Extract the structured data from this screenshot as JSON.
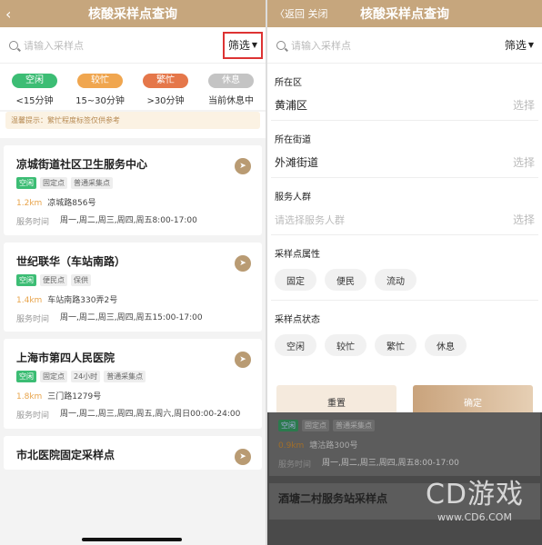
{
  "left": {
    "header": {
      "title": "核酸采样点查询",
      "back_icon": "‹"
    },
    "search": {
      "placeholder": "请输入采样点",
      "filter_label": "筛选",
      "filter_icon": "▼"
    },
    "legend": [
      {
        "chip": "空闲",
        "text": "<15分钟",
        "color": "#3cbd74"
      },
      {
        "chip": "较忙",
        "text": "15~30分钟",
        "color": "#f0a64f"
      },
      {
        "chip": "繁忙",
        "text": ">30分钟",
        "color": "#e5774a"
      },
      {
        "chip": "休息",
        "text": "当前休息中",
        "color": "#c4c4c4"
      }
    ],
    "tip": "温馨提示：繁忙程度标签仅供参考",
    "cards": [
      {
        "name": "凉城街道社区卫生服务中心",
        "tags": [
          "空闲",
          "固定点",
          "普通采集点"
        ],
        "km": "1.2km",
        "address": "凉城路856号",
        "hours_label": "服务时间",
        "hours": "周一,周二,周三,周四,周五8:00-17:00"
      },
      {
        "name": "世纪联华（车站南路）",
        "tags": [
          "空闲",
          "便民点",
          "保供"
        ],
        "km": "1.4km",
        "address": "车站南路330弄2号",
        "hours_label": "服务时间",
        "hours": "周一,周二,周三,周四,周五15:00-17:00"
      },
      {
        "name": "上海市第四人民医院",
        "tags": [
          "空闲",
          "固定点",
          "24小时",
          "普通采集点"
        ],
        "km": "1.8km",
        "address": "三门路1279号",
        "hours_label": "服务时间",
        "hours": "周一,周二,周三,周四,周五,周六,周日00:00-24:00"
      },
      {
        "name": "市北医院固定采样点",
        "tags": [],
        "km": "",
        "address": "",
        "hours_label": "",
        "hours": ""
      }
    ]
  },
  "right": {
    "header": {
      "back": "〈返回",
      "close": "关闭",
      "title": "核酸采样点查询"
    },
    "search": {
      "placeholder": "请输入采样点",
      "filter_label": "筛选",
      "filter_icon": "▼"
    },
    "district": {
      "label": "所在区",
      "value": "黄浦区",
      "action": "选择"
    },
    "street": {
      "label": "所在街道",
      "value": "外滩街道",
      "action": "选择"
    },
    "crowd": {
      "label": "服务人群",
      "placeholder": "请选择服务人群",
      "action": "选择"
    },
    "attr": {
      "label": "采样点属性",
      "options": [
        "固定",
        "便民",
        "流动"
      ]
    },
    "status": {
      "label": "采样点状态",
      "options": [
        "空闲",
        "较忙",
        "繁忙",
        "休息"
      ]
    },
    "reset": "重置",
    "confirm": "确定",
    "behind": {
      "tags": [
        "空闲",
        "固定点",
        "普通采集点"
      ],
      "km": "0.9km",
      "address": "塘沽路300号",
      "hours_label": "服务时间",
      "hours": "周一,周二,周三,周四,周五8:00-17:00",
      "next_name": "酒塘二村服务站采样点"
    },
    "watermark": {
      "logo": "CD游戏",
      "url": "www.CD6.COM"
    }
  }
}
